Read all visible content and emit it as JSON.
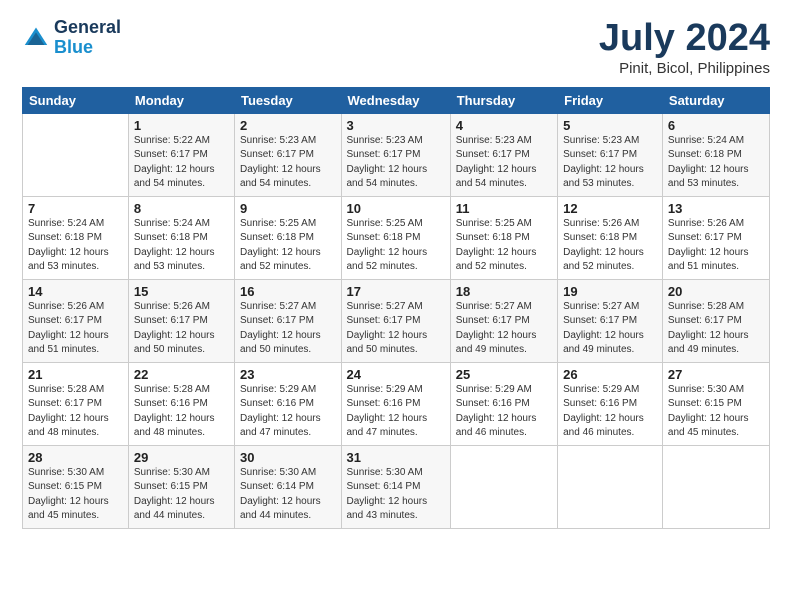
{
  "header": {
    "logo": {
      "general": "General",
      "blue": "Blue"
    },
    "title": "July 2024",
    "location": "Pinit, Bicol, Philippines"
  },
  "weekdays": [
    "Sunday",
    "Monday",
    "Tuesday",
    "Wednesday",
    "Thursday",
    "Friday",
    "Saturday"
  ],
  "weeks": [
    [
      {
        "day": null
      },
      {
        "day": "1",
        "sunrise": "5:22 AM",
        "sunset": "6:17 PM",
        "daylight": "12 hours and 54 minutes."
      },
      {
        "day": "2",
        "sunrise": "5:23 AM",
        "sunset": "6:17 PM",
        "daylight": "12 hours and 54 minutes."
      },
      {
        "day": "3",
        "sunrise": "5:23 AM",
        "sunset": "6:17 PM",
        "daylight": "12 hours and 54 minutes."
      },
      {
        "day": "4",
        "sunrise": "5:23 AM",
        "sunset": "6:17 PM",
        "daylight": "12 hours and 54 minutes."
      },
      {
        "day": "5",
        "sunrise": "5:23 AM",
        "sunset": "6:17 PM",
        "daylight": "12 hours and 53 minutes."
      },
      {
        "day": "6",
        "sunrise": "5:24 AM",
        "sunset": "6:18 PM",
        "daylight": "12 hours and 53 minutes."
      }
    ],
    [
      {
        "day": "7",
        "sunrise": "5:24 AM",
        "sunset": "6:18 PM",
        "daylight": "12 hours and 53 minutes."
      },
      {
        "day": "8",
        "sunrise": "5:24 AM",
        "sunset": "6:18 PM",
        "daylight": "12 hours and 53 minutes."
      },
      {
        "day": "9",
        "sunrise": "5:25 AM",
        "sunset": "6:18 PM",
        "daylight": "12 hours and 52 minutes."
      },
      {
        "day": "10",
        "sunrise": "5:25 AM",
        "sunset": "6:18 PM",
        "daylight": "12 hours and 52 minutes."
      },
      {
        "day": "11",
        "sunrise": "5:25 AM",
        "sunset": "6:18 PM",
        "daylight": "12 hours and 52 minutes."
      },
      {
        "day": "12",
        "sunrise": "5:26 AM",
        "sunset": "6:18 PM",
        "daylight": "12 hours and 52 minutes."
      },
      {
        "day": "13",
        "sunrise": "5:26 AM",
        "sunset": "6:17 PM",
        "daylight": "12 hours and 51 minutes."
      }
    ],
    [
      {
        "day": "14",
        "sunrise": "5:26 AM",
        "sunset": "6:17 PM",
        "daylight": "12 hours and 51 minutes."
      },
      {
        "day": "15",
        "sunrise": "5:26 AM",
        "sunset": "6:17 PM",
        "daylight": "12 hours and 50 minutes."
      },
      {
        "day": "16",
        "sunrise": "5:27 AM",
        "sunset": "6:17 PM",
        "daylight": "12 hours and 50 minutes."
      },
      {
        "day": "17",
        "sunrise": "5:27 AM",
        "sunset": "6:17 PM",
        "daylight": "12 hours and 50 minutes."
      },
      {
        "day": "18",
        "sunrise": "5:27 AM",
        "sunset": "6:17 PM",
        "daylight": "12 hours and 49 minutes."
      },
      {
        "day": "19",
        "sunrise": "5:27 AM",
        "sunset": "6:17 PM",
        "daylight": "12 hours and 49 minutes."
      },
      {
        "day": "20",
        "sunrise": "5:28 AM",
        "sunset": "6:17 PM",
        "daylight": "12 hours and 49 minutes."
      }
    ],
    [
      {
        "day": "21",
        "sunrise": "5:28 AM",
        "sunset": "6:17 PM",
        "daylight": "12 hours and 48 minutes."
      },
      {
        "day": "22",
        "sunrise": "5:28 AM",
        "sunset": "6:16 PM",
        "daylight": "12 hours and 48 minutes."
      },
      {
        "day": "23",
        "sunrise": "5:29 AM",
        "sunset": "6:16 PM",
        "daylight": "12 hours and 47 minutes."
      },
      {
        "day": "24",
        "sunrise": "5:29 AM",
        "sunset": "6:16 PM",
        "daylight": "12 hours and 47 minutes."
      },
      {
        "day": "25",
        "sunrise": "5:29 AM",
        "sunset": "6:16 PM",
        "daylight": "12 hours and 46 minutes."
      },
      {
        "day": "26",
        "sunrise": "5:29 AM",
        "sunset": "6:16 PM",
        "daylight": "12 hours and 46 minutes."
      },
      {
        "day": "27",
        "sunrise": "5:30 AM",
        "sunset": "6:15 PM",
        "daylight": "12 hours and 45 minutes."
      }
    ],
    [
      {
        "day": "28",
        "sunrise": "5:30 AM",
        "sunset": "6:15 PM",
        "daylight": "12 hours and 45 minutes."
      },
      {
        "day": "29",
        "sunrise": "5:30 AM",
        "sunset": "6:15 PM",
        "daylight": "12 hours and 44 minutes."
      },
      {
        "day": "30",
        "sunrise": "5:30 AM",
        "sunset": "6:14 PM",
        "daylight": "12 hours and 44 minutes."
      },
      {
        "day": "31",
        "sunrise": "5:30 AM",
        "sunset": "6:14 PM",
        "daylight": "12 hours and 43 minutes."
      },
      {
        "day": null
      },
      {
        "day": null
      },
      {
        "day": null
      }
    ]
  ]
}
